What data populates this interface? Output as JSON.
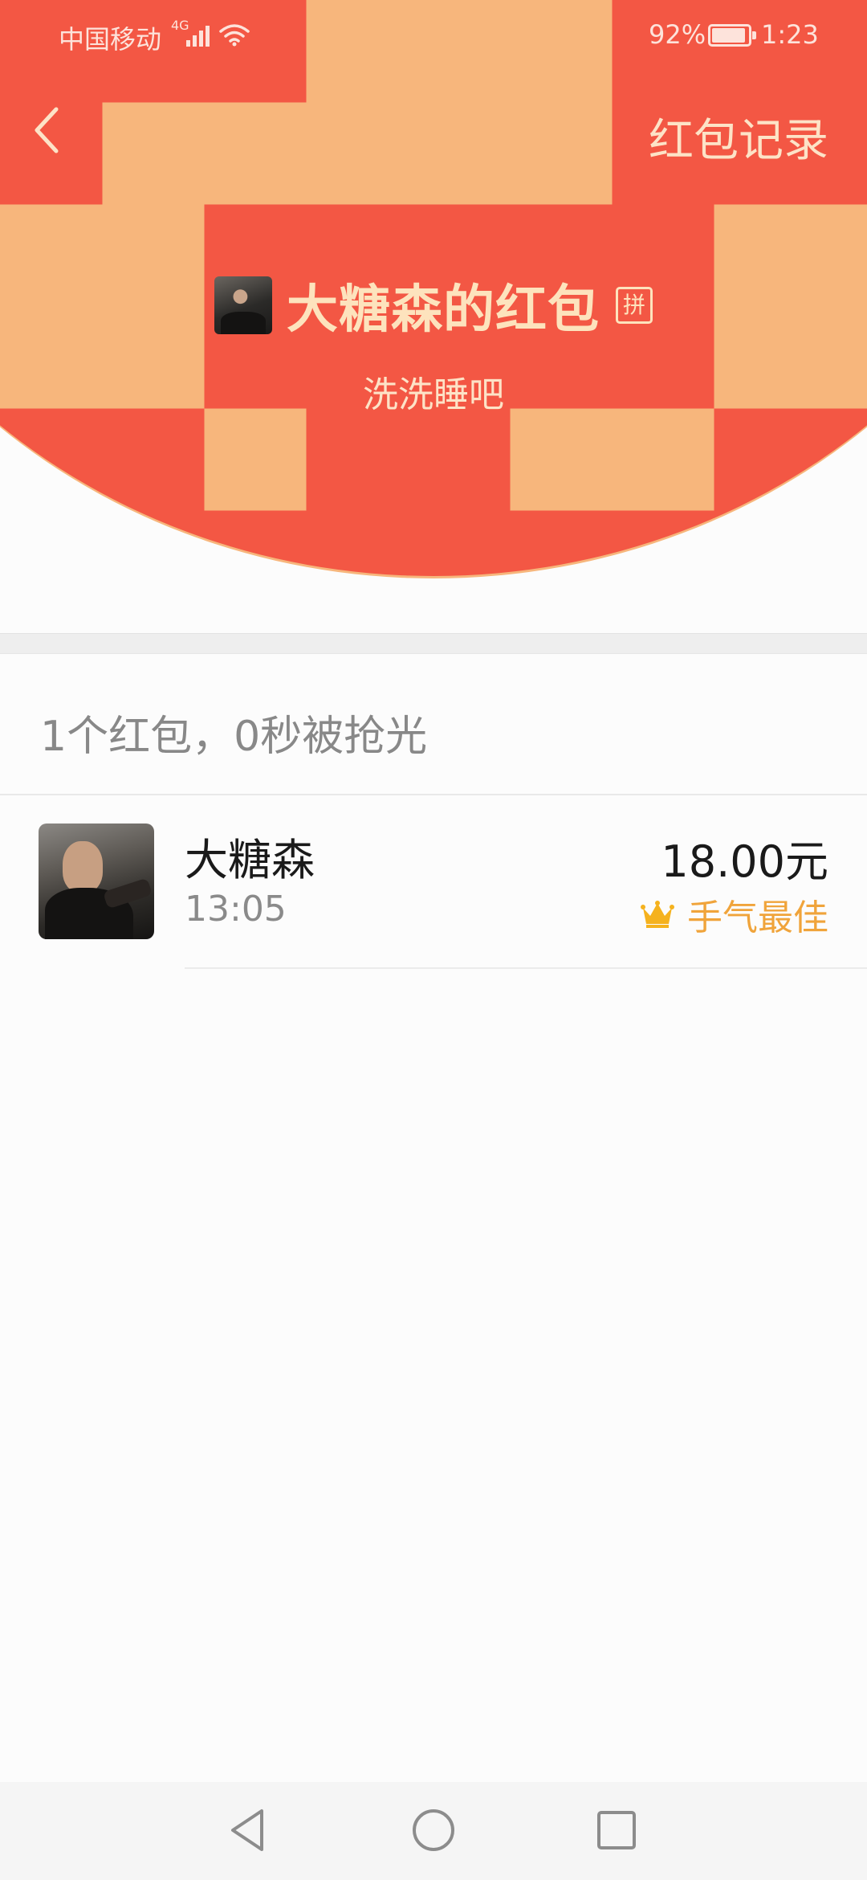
{
  "status_bar": {
    "carrier": "中国移动",
    "network": "4G",
    "battery_percent": "92%",
    "time": "1:23"
  },
  "nav": {
    "records_label": "红包记录"
  },
  "packet": {
    "title": "大糖森的红包",
    "pin_badge": "拼",
    "message": "洗洗睡吧"
  },
  "summary": {
    "text": "1个红包，0秒被抢光"
  },
  "grabs": [
    {
      "name": "大糖森",
      "time": "13:05",
      "amount": "18.00元",
      "badge": "手气最佳"
    }
  ],
  "colors": {
    "header_red": "#f35744",
    "title_gold": "#fde3bd",
    "best_luck_orange": "#f0a43b"
  }
}
